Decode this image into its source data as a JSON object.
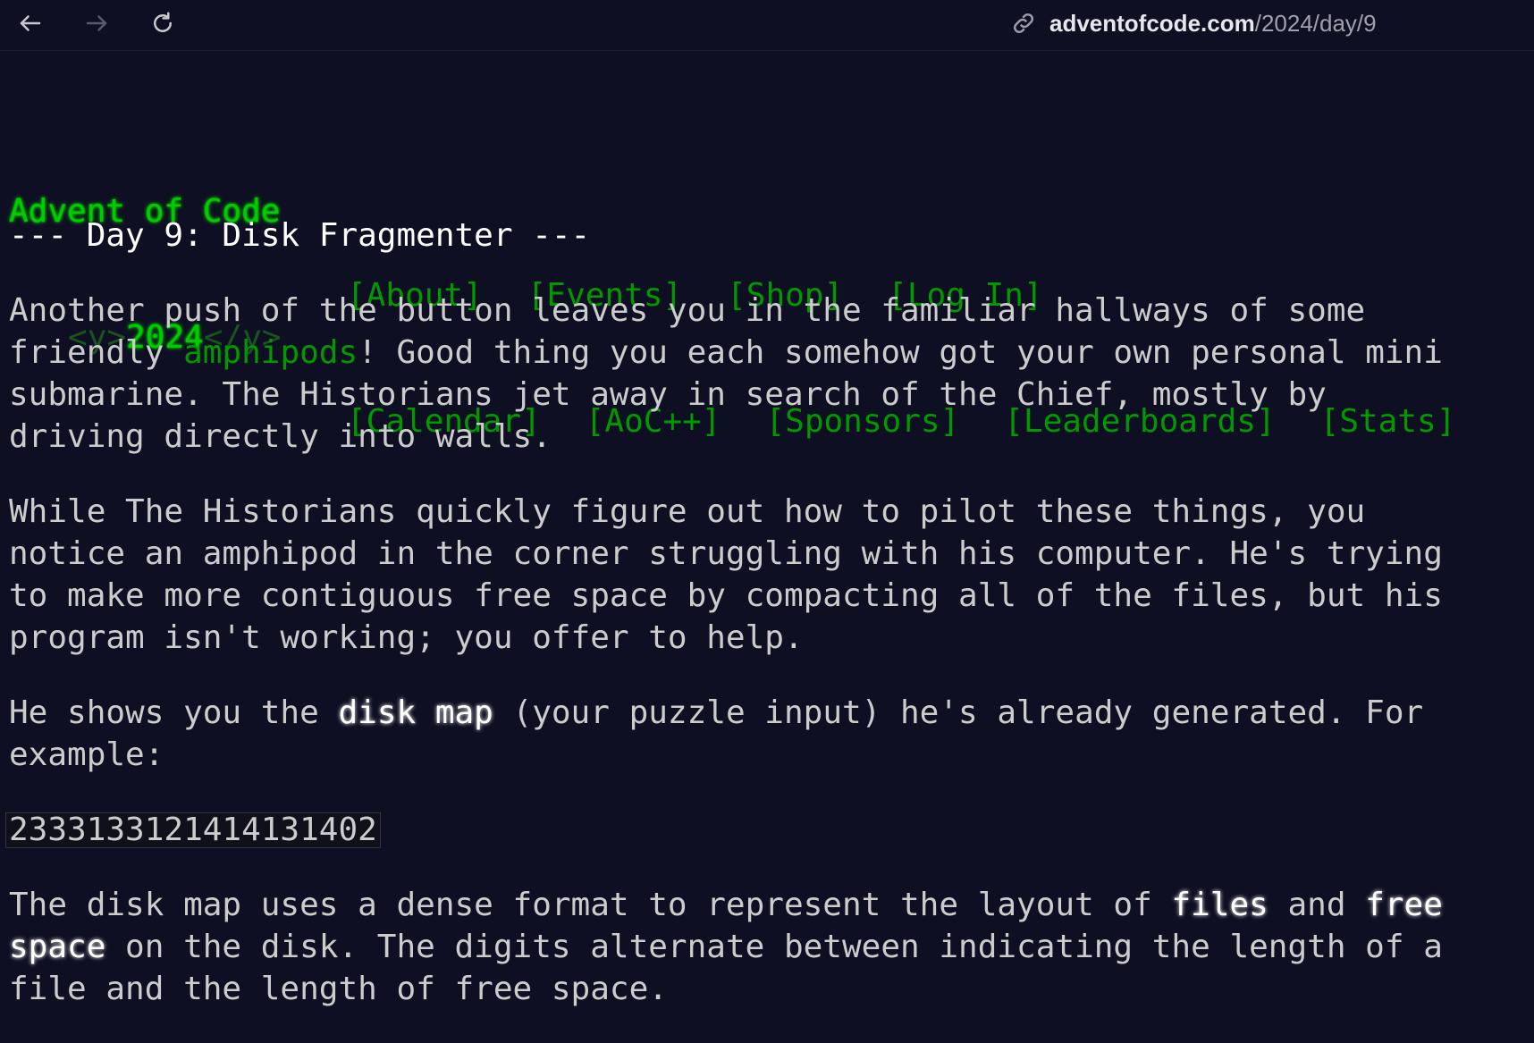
{
  "browser": {
    "url_host": "adventofcode.com",
    "url_path": "/2024/day/9"
  },
  "header": {
    "title": "Advent of Code",
    "year_prefix": "<y>",
    "year": "2024",
    "year_suffix": "</y>",
    "menu_row1": [
      "[About]",
      "[Events]",
      "[Shop]",
      "[Log In]"
    ],
    "menu_row2": [
      "[Calendar]",
      "[AoC++]",
      "[Sponsors]",
      "[Leaderboards]",
      "[Stats]"
    ]
  },
  "article": {
    "heading": "--- Day 9: Disk Fragmenter ---",
    "p1": {
      "line1": "Another push of the button leaves you in the familiar hallways of some",
      "before_link": "friendly ",
      "link": "amphipods",
      "after_link": "! Good thing you each somehow got your own personal mini",
      "line3": "submarine. The Historians jet away in search of the Chief, mostly by",
      "line4": "driving directly into walls."
    },
    "p2": {
      "line1": "While The Historians quickly figure out how to pilot these things, you",
      "line2": "notice an amphipod in the corner struggling with his computer. He's trying",
      "line3": "to make more contiguous free space by compacting all of the files, but his",
      "line4": "program isn't working; you offer to help."
    },
    "p3": {
      "before_em": "He shows you the ",
      "em": "disk map",
      "after_em": " (your puzzle input) he's already generated. For",
      "line2": "example:"
    },
    "example_code": "2333133121414131402",
    "p4": {
      "t1": "The disk map uses a dense format to represent the layout of ",
      "em1": "files",
      "t2": " and ",
      "em2a": "free",
      "em2b": "space",
      "t3": " on the disk. The digits alternate between indicating the length of a",
      "line3": "file and the length of free space."
    }
  }
}
